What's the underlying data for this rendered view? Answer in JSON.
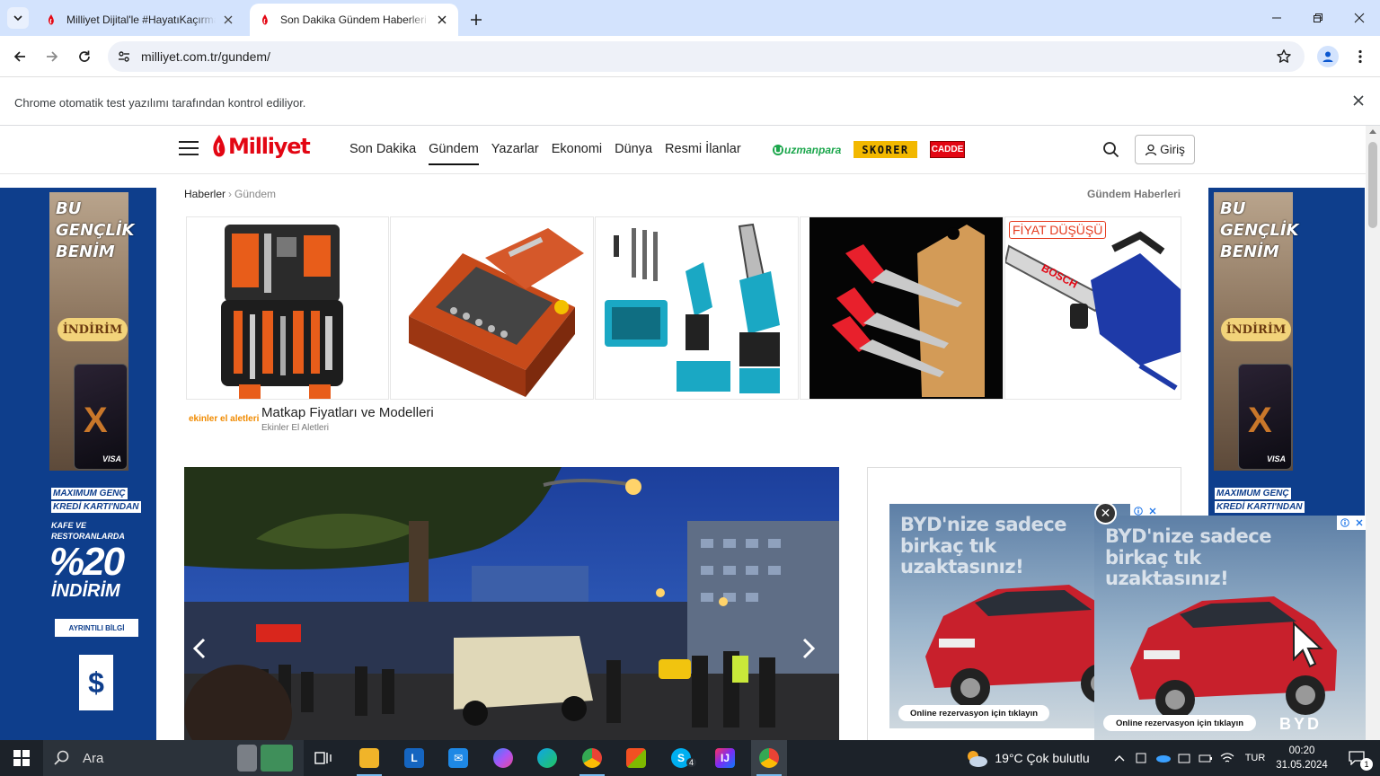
{
  "browser": {
    "tabs": [
      {
        "title": "Milliyet Dijital'le #HayatıKaçırma",
        "active": false
      },
      {
        "title": "Son Dakika Gündem Haberleri",
        "active": true
      }
    ],
    "url": "milliyet.com.tr/gundem/",
    "infobar_message": "Chrome otomatik test yazılımı tarafından kontrol ediliyor."
  },
  "site": {
    "logo": "Milliyet",
    "nav": [
      "Son Dakika",
      "Gündem",
      "Yazarlar",
      "Ekonomi",
      "Dünya",
      "Resmi İlanlar"
    ],
    "active_nav": "Gündem",
    "partners": [
      "uzmanpara",
      "SKORER",
      "CADDE"
    ],
    "login_label": "Giriş",
    "breadcrumb": {
      "root": "Haberler",
      "current": "Gündem"
    },
    "section_link": "Gündem Haberleri"
  },
  "side_banner": {
    "headline": "BU GENÇLİK BENİM",
    "badge": "İNDİRİM",
    "card_brand": "VISA",
    "promo_line1": "MAXIMUM GENÇ",
    "promo_line2": "KREDİ KARTI'NDAN",
    "promo_detail": "KAFE VE RESTORANLARDA",
    "percent": "%20",
    "discount": "İNDİRİM",
    "button": "AYRINTILI BİLGİ"
  },
  "product_ad": {
    "badge": "FİYAT DÜŞÜŞÜ",
    "brand": "ekinler el aletleri",
    "title": "Matkap Fiyatları ve Modelleri",
    "subtitle": "Ekinler El Aletleri",
    "saw_brand": "BOSCH"
  },
  "byd_ad": {
    "headline": "BYD'nize sadece birkaç tık uzaktasınız!",
    "cta": "Online rezervasyon için tıklayın",
    "brand": "BYD"
  },
  "taskbar": {
    "search_placeholder": "Ara",
    "weather": "19°C  Çok bulutlu",
    "language": "TUR",
    "time": "00:20",
    "date": "31.05.2024",
    "notifications": "1",
    "skype_badge": "4"
  }
}
